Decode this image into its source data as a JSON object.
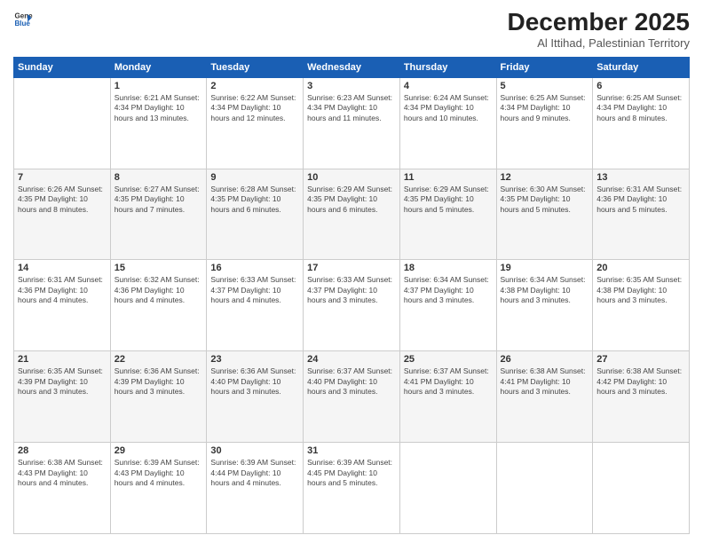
{
  "logo": {
    "line1": "General",
    "line2": "Blue"
  },
  "title": "December 2025",
  "subtitle": "Al Ittihad, Palestinian Territory",
  "days": [
    "Sunday",
    "Monday",
    "Tuesday",
    "Wednesday",
    "Thursday",
    "Friday",
    "Saturday"
  ],
  "weeks": [
    [
      {
        "day": "",
        "info": ""
      },
      {
        "day": "1",
        "info": "Sunrise: 6:21 AM\nSunset: 4:34 PM\nDaylight: 10 hours\nand 13 minutes."
      },
      {
        "day": "2",
        "info": "Sunrise: 6:22 AM\nSunset: 4:34 PM\nDaylight: 10 hours\nand 12 minutes."
      },
      {
        "day": "3",
        "info": "Sunrise: 6:23 AM\nSunset: 4:34 PM\nDaylight: 10 hours\nand 11 minutes."
      },
      {
        "day": "4",
        "info": "Sunrise: 6:24 AM\nSunset: 4:34 PM\nDaylight: 10 hours\nand 10 minutes."
      },
      {
        "day": "5",
        "info": "Sunrise: 6:25 AM\nSunset: 4:34 PM\nDaylight: 10 hours\nand 9 minutes."
      },
      {
        "day": "6",
        "info": "Sunrise: 6:25 AM\nSunset: 4:34 PM\nDaylight: 10 hours\nand 8 minutes."
      }
    ],
    [
      {
        "day": "7",
        "info": "Sunrise: 6:26 AM\nSunset: 4:35 PM\nDaylight: 10 hours\nand 8 minutes."
      },
      {
        "day": "8",
        "info": "Sunrise: 6:27 AM\nSunset: 4:35 PM\nDaylight: 10 hours\nand 7 minutes."
      },
      {
        "day": "9",
        "info": "Sunrise: 6:28 AM\nSunset: 4:35 PM\nDaylight: 10 hours\nand 6 minutes."
      },
      {
        "day": "10",
        "info": "Sunrise: 6:29 AM\nSunset: 4:35 PM\nDaylight: 10 hours\nand 6 minutes."
      },
      {
        "day": "11",
        "info": "Sunrise: 6:29 AM\nSunset: 4:35 PM\nDaylight: 10 hours\nand 5 minutes."
      },
      {
        "day": "12",
        "info": "Sunrise: 6:30 AM\nSunset: 4:35 PM\nDaylight: 10 hours\nand 5 minutes."
      },
      {
        "day": "13",
        "info": "Sunrise: 6:31 AM\nSunset: 4:36 PM\nDaylight: 10 hours\nand 5 minutes."
      }
    ],
    [
      {
        "day": "14",
        "info": "Sunrise: 6:31 AM\nSunset: 4:36 PM\nDaylight: 10 hours\nand 4 minutes."
      },
      {
        "day": "15",
        "info": "Sunrise: 6:32 AM\nSunset: 4:36 PM\nDaylight: 10 hours\nand 4 minutes."
      },
      {
        "day": "16",
        "info": "Sunrise: 6:33 AM\nSunset: 4:37 PM\nDaylight: 10 hours\nand 4 minutes."
      },
      {
        "day": "17",
        "info": "Sunrise: 6:33 AM\nSunset: 4:37 PM\nDaylight: 10 hours\nand 3 minutes."
      },
      {
        "day": "18",
        "info": "Sunrise: 6:34 AM\nSunset: 4:37 PM\nDaylight: 10 hours\nand 3 minutes."
      },
      {
        "day": "19",
        "info": "Sunrise: 6:34 AM\nSunset: 4:38 PM\nDaylight: 10 hours\nand 3 minutes."
      },
      {
        "day": "20",
        "info": "Sunrise: 6:35 AM\nSunset: 4:38 PM\nDaylight: 10 hours\nand 3 minutes."
      }
    ],
    [
      {
        "day": "21",
        "info": "Sunrise: 6:35 AM\nSunset: 4:39 PM\nDaylight: 10 hours\nand 3 minutes."
      },
      {
        "day": "22",
        "info": "Sunrise: 6:36 AM\nSunset: 4:39 PM\nDaylight: 10 hours\nand 3 minutes."
      },
      {
        "day": "23",
        "info": "Sunrise: 6:36 AM\nSunset: 4:40 PM\nDaylight: 10 hours\nand 3 minutes."
      },
      {
        "day": "24",
        "info": "Sunrise: 6:37 AM\nSunset: 4:40 PM\nDaylight: 10 hours\nand 3 minutes."
      },
      {
        "day": "25",
        "info": "Sunrise: 6:37 AM\nSunset: 4:41 PM\nDaylight: 10 hours\nand 3 minutes."
      },
      {
        "day": "26",
        "info": "Sunrise: 6:38 AM\nSunset: 4:41 PM\nDaylight: 10 hours\nand 3 minutes."
      },
      {
        "day": "27",
        "info": "Sunrise: 6:38 AM\nSunset: 4:42 PM\nDaylight: 10 hours\nand 3 minutes."
      }
    ],
    [
      {
        "day": "28",
        "info": "Sunrise: 6:38 AM\nSunset: 4:43 PM\nDaylight: 10 hours\nand 4 minutes."
      },
      {
        "day": "29",
        "info": "Sunrise: 6:39 AM\nSunset: 4:43 PM\nDaylight: 10 hours\nand 4 minutes."
      },
      {
        "day": "30",
        "info": "Sunrise: 6:39 AM\nSunset: 4:44 PM\nDaylight: 10 hours\nand 4 minutes."
      },
      {
        "day": "31",
        "info": "Sunrise: 6:39 AM\nSunset: 4:45 PM\nDaylight: 10 hours\nand 5 minutes."
      },
      {
        "day": "",
        "info": ""
      },
      {
        "day": "",
        "info": ""
      },
      {
        "day": "",
        "info": ""
      }
    ]
  ]
}
